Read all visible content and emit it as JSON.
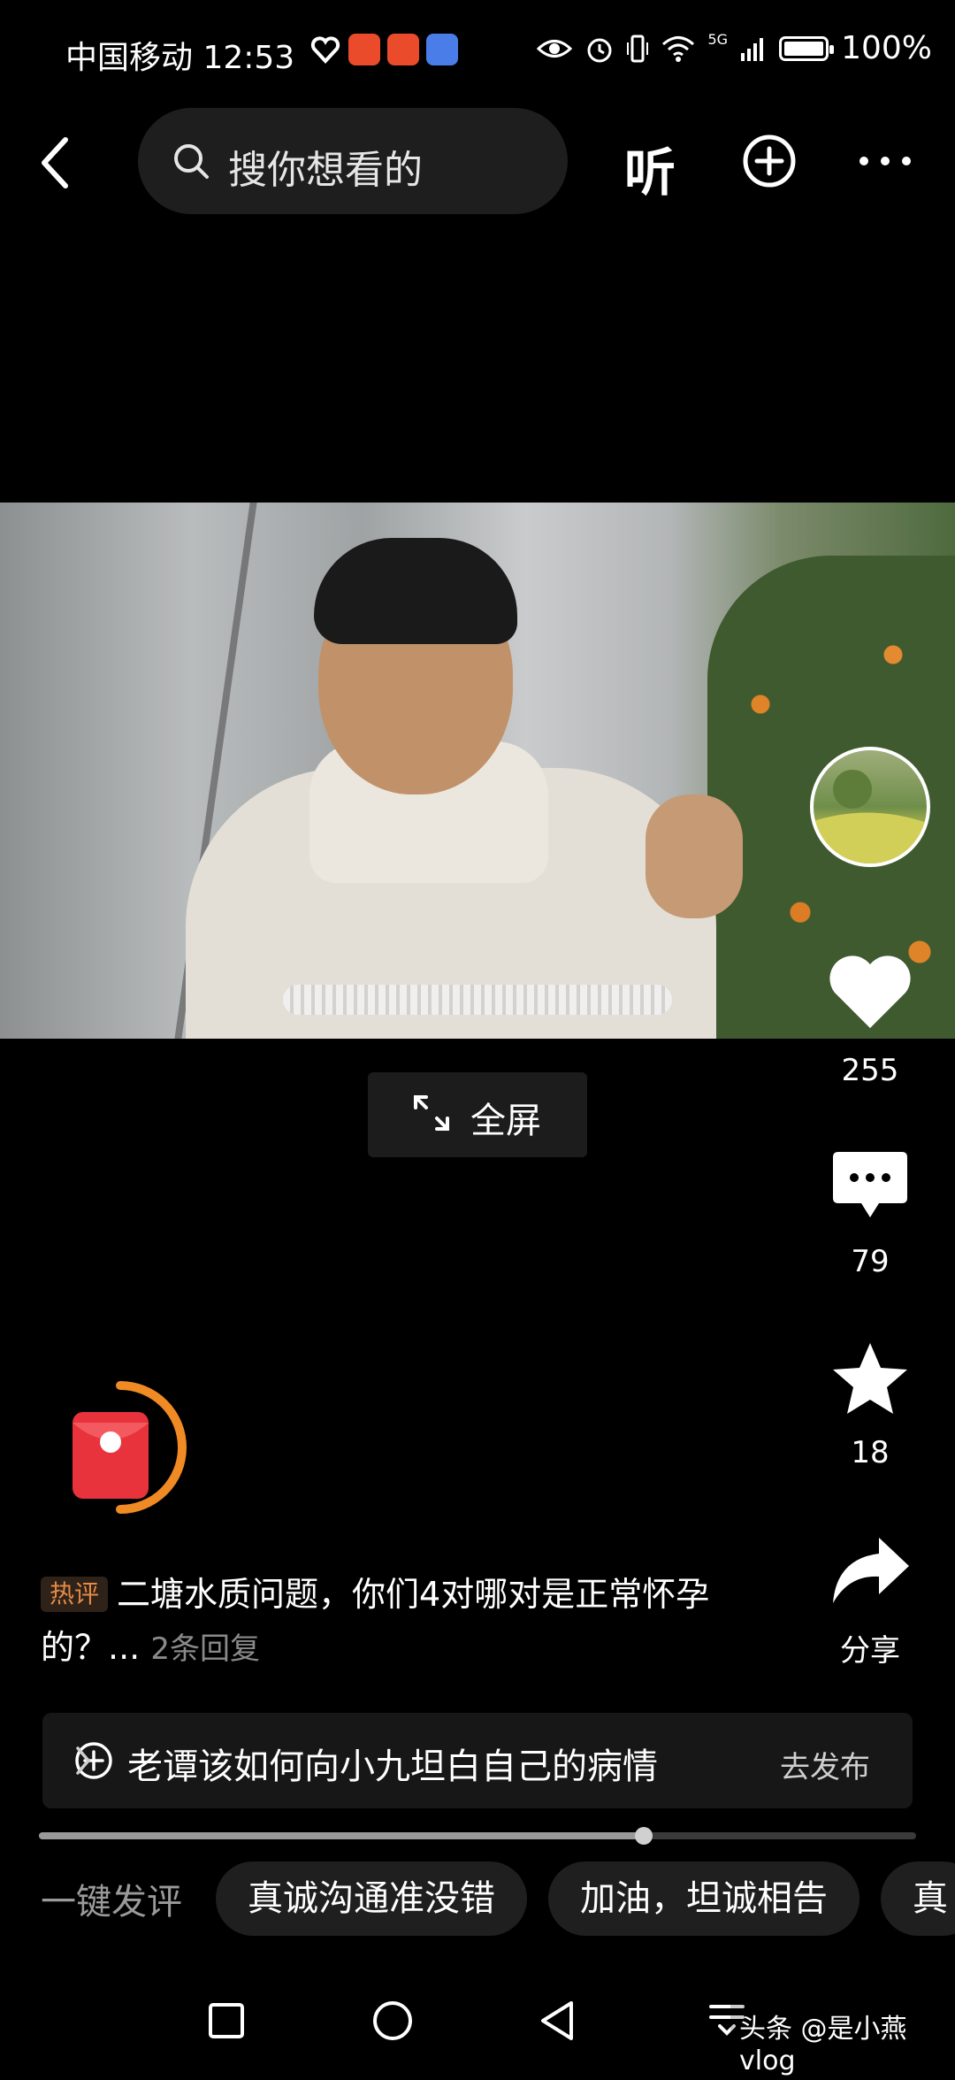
{
  "status_bar": {
    "carrier_time": "中国移动 12:53",
    "battery_text": "100%",
    "signal_label": "5G"
  },
  "header": {
    "search_placeholder": "搜你想看的",
    "listen_label": "听"
  },
  "player": {
    "fullscreen_label": "全屏",
    "progress": 0.69
  },
  "rail": {
    "like_count": "255",
    "comment_count": "79",
    "favorite_count": "18",
    "share_label": "分享"
  },
  "hot_comment": {
    "tag": "热评",
    "text": "二塘水质问题，你们4对哪对是正常怀孕的？...",
    "replies": "2条回复"
  },
  "topic": {
    "text": "老谭该如何向小九坦白自己的病情",
    "action": "去发布"
  },
  "quick_comments": {
    "label": "一键发评",
    "chips": [
      "真诚沟通准没错",
      "加油，坦诚相告",
      "真"
    ]
  },
  "watermark": "头条 @是小燕vlog",
  "colors": {
    "background": "#000000",
    "hot_tag": "#e58a45",
    "red_packet": "#e8333c",
    "ring": "#f08a24"
  }
}
